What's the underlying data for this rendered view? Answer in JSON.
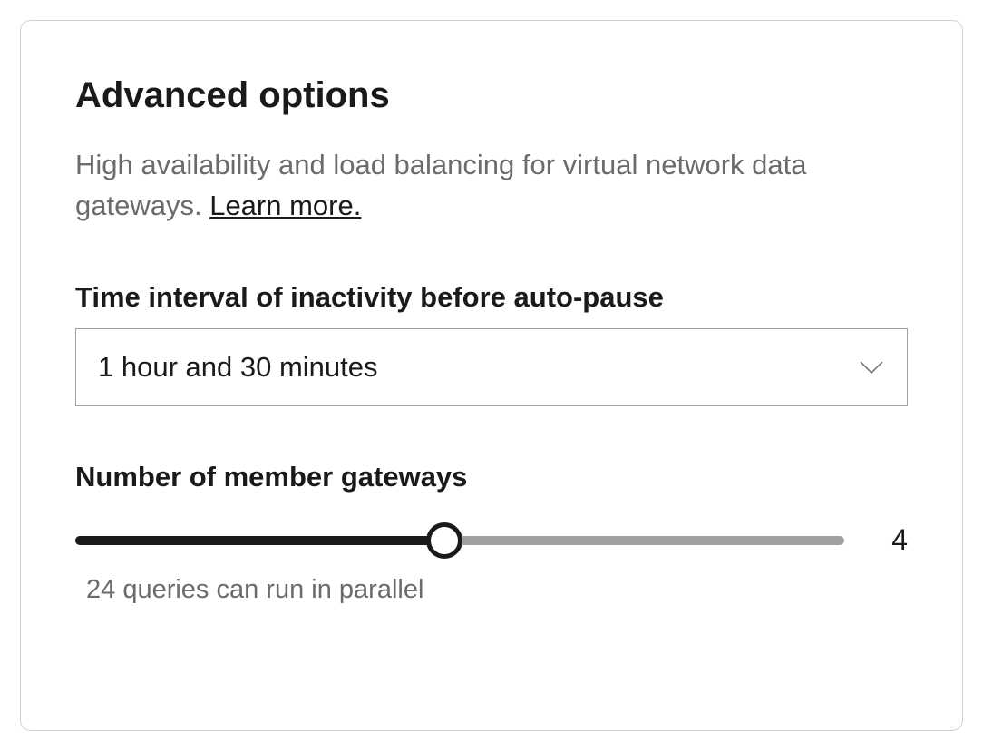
{
  "panel": {
    "title": "Advanced options",
    "description_prefix": "High availability and load balancing for virtual network data gateways. ",
    "learn_more_label": "Learn more."
  },
  "time_interval": {
    "label": "Time interval of inactivity before auto-pause",
    "value": "1 hour and 30 minutes"
  },
  "gateways": {
    "label": "Number of member gateways",
    "value": "4",
    "helper": "24 queries can run in parallel"
  }
}
